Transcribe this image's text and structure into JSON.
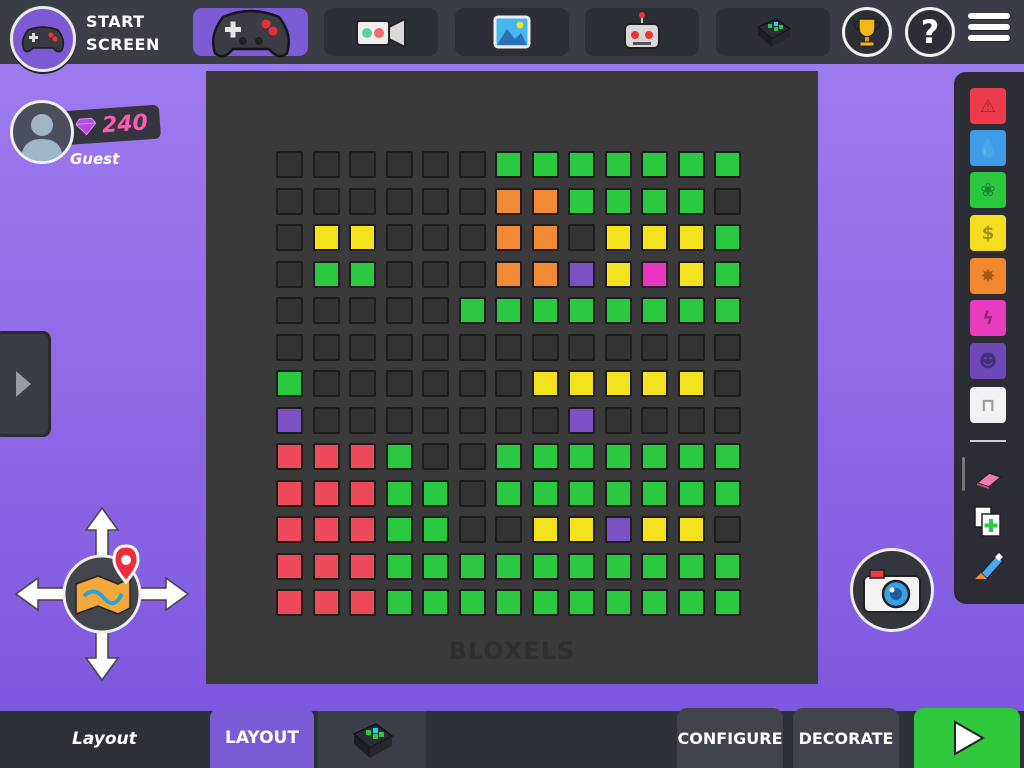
{
  "header": {
    "start_label_line1": "START",
    "start_label_line2": "SCREEN",
    "tabs": [
      {
        "name": "games",
        "icon": "gamepad-icon",
        "active": true
      },
      {
        "name": "animations",
        "icon": "projector-icon",
        "active": false
      },
      {
        "name": "backgrounds",
        "icon": "landscape-icon",
        "active": false
      },
      {
        "name": "characters",
        "icon": "robot-icon",
        "active": false
      },
      {
        "name": "boards",
        "icon": "board-icon",
        "active": false
      }
    ],
    "trophy_icon": "trophy-icon",
    "help_glyph": "?",
    "menu_icon": "hamburger-icon"
  },
  "profile": {
    "gems": "240",
    "username": "Guest"
  },
  "board": {
    "brand": "BLOXELS",
    "rows": [
      "______ggggggg",
      "______oogggg_",
      "_yy___oo_yyyg",
      "_gg___oopykyg",
      "_____gggggggg",
      "_____________",
      "g______yyyyy_",
      "p_______p____",
      "rrrg__ggggggg",
      "rrrgg_ggggggg",
      "rrrgg__yypyy_",
      "rrrgggggggggg",
      "rrrgggggggggg"
    ]
  },
  "palette": {
    "items": [
      {
        "name": "hazard",
        "color": "#ee3b4c",
        "glyph": "⚠"
      },
      {
        "name": "water",
        "color": "#3f9ce6",
        "glyph": "💧"
      },
      {
        "name": "terrain",
        "color": "#2cc63f",
        "glyph": "❀"
      },
      {
        "name": "coin",
        "color": "#f5de1f",
        "glyph": "$"
      },
      {
        "name": "enemy",
        "color": "#f2872e",
        "glyph": "✸"
      },
      {
        "name": "power-up",
        "color": "#e83bbd",
        "glyph": "ϟ"
      },
      {
        "name": "npc",
        "color": "#6f48b8",
        "glyph": "☻"
      },
      {
        "name": "story",
        "color": "#f2f2f2",
        "glyph": "⊓"
      }
    ],
    "tools": [
      {
        "name": "eraser",
        "icon": "eraser-icon"
      },
      {
        "name": "copy",
        "icon": "copy-add-icon"
      },
      {
        "name": "fill",
        "icon": "glue-icon"
      }
    ]
  },
  "bottom": {
    "title": "Layout",
    "mode_label": "LAYOUT",
    "configure_label": "CONFIGURE",
    "decorate_label": "DECORATE"
  }
}
